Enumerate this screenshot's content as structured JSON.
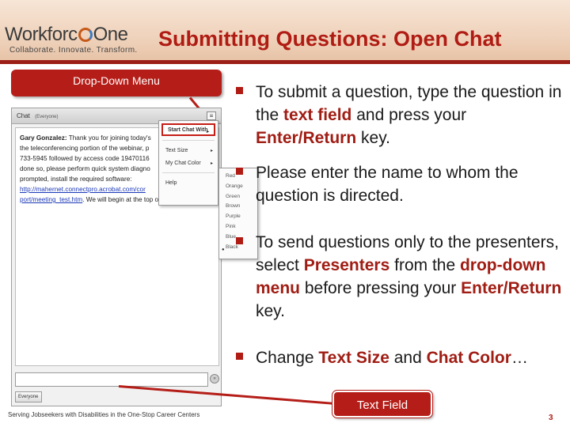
{
  "header": {
    "logo_word": "Workforc",
    "logo_one": "One",
    "logo_tagline": "Collaborate.  Innovate.  Transform.",
    "title": "Submitting Questions: Open Chat"
  },
  "callouts": {
    "dropdown": "Drop-Down Menu",
    "text_field": "Text Field"
  },
  "chat_pod": {
    "title": "Chat",
    "audience": "(Everyone)",
    "menu_button": "≡",
    "message": {
      "sender": "Gary Gonzalez:",
      "lines": [
        " Thank you for joining today's",
        "the teleconferencing portion of the webinar, p",
        "733-5945 followed by access code 19470116",
        "done so, please perform quick system diagno",
        "prompted, install the required software:"
      ],
      "link1": "http://mahernet.connectpro.acrobat.com/cor",
      "link2": "port/meeting_test.htm",
      "tail": ". We will begin at the top of the hour."
    },
    "send_icon_glyph": "»",
    "footer_tab": "Everyone"
  },
  "menu_main": {
    "items": [
      "Start Chat With",
      "Text Size",
      "My Chat Color",
      "Help"
    ],
    "arrow_glyph": "▸"
  },
  "menu_color": {
    "items": [
      "Red",
      "Orange",
      "Green",
      "Brown",
      "Purple",
      "Pink",
      "Blue",
      "Black"
    ],
    "check_glyph": "●"
  },
  "bullets": {
    "b1": {
      "t1": "To submit a question, type the question in the ",
      "h1": "text field",
      "t2": " and press your ",
      "h2": "Enter/Return",
      "t3": " key."
    },
    "b2": {
      "t1": "Please enter the name to whom the question is directed."
    },
    "b3": {
      "t1": "To send questions only to the presenters, select ",
      "h1": "Presenters",
      "t2": " from the ",
      "h2": "drop-down menu",
      "t3": " before pressing your ",
      "h3": "Enter/Return",
      "t4": " key."
    },
    "b4": {
      "t1": "Change ",
      "h1": "Text Size",
      "t2": " and ",
      "h2": "Chat Color",
      "t3": "…"
    }
  },
  "footer": {
    "text": "Serving Jobseekers with Disabilities in the One-Stop Career Centers",
    "page": "3"
  },
  "colors": {
    "accent": "#b01c14",
    "callout": "#b51e18",
    "link": "#1b38b8"
  }
}
